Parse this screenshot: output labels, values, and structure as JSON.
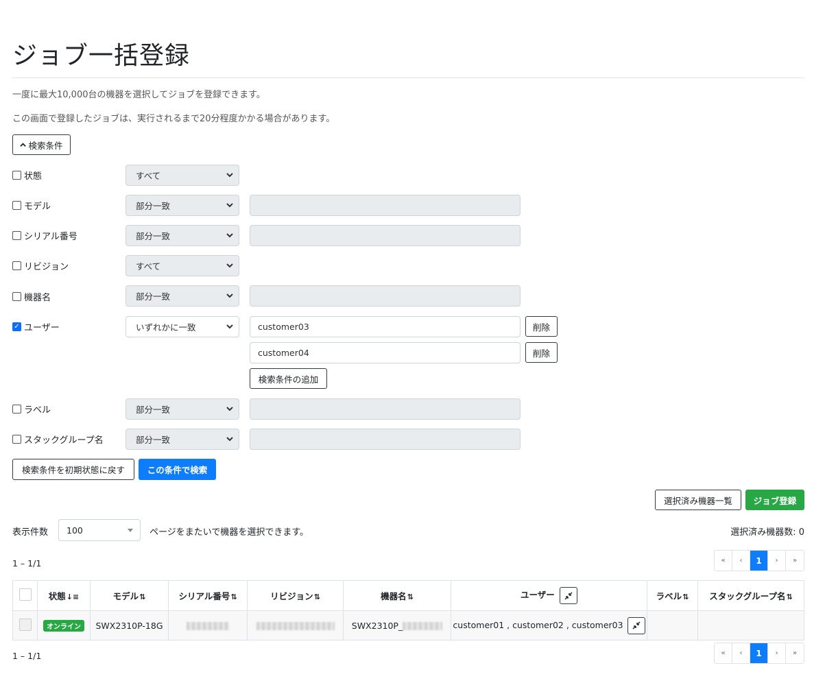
{
  "page": {
    "title": "ジョブ一括登録",
    "desc1": "一度に最大10,000台の機器を選択してジョブを登録できます。",
    "desc2": "この画面で登録したジョブは、実行されるまで20分程度かかる場合があります。"
  },
  "search": {
    "toggle_label": "検索条件",
    "conditions": [
      {
        "label": "状態",
        "checked": false,
        "match": "すべて"
      },
      {
        "label": "モデル",
        "checked": false,
        "match": "部分一致",
        "value": ""
      },
      {
        "label": "シリアル番号",
        "checked": false,
        "match": "部分一致",
        "value": ""
      },
      {
        "label": "リビジョン",
        "checked": false,
        "match": "すべて"
      },
      {
        "label": "機器名",
        "checked": false,
        "match": "部分一致",
        "value": ""
      },
      {
        "label": "ユーザー",
        "checked": true,
        "match": "いずれかに一致",
        "values": [
          "customer03",
          "customer04"
        ]
      },
      {
        "label": "ラベル",
        "checked": false,
        "match": "部分一致",
        "value": ""
      },
      {
        "label": "スタックグループ名",
        "checked": false,
        "match": "部分一致",
        "value": ""
      }
    ],
    "delete_label": "削除",
    "add_condition_label": "検索条件の追加",
    "reset_label": "検索条件を初期状態に戻す",
    "search_label": "この条件で検索"
  },
  "actions": {
    "selected_list_label": "選択済み機器一覧",
    "register_label": "ジョブ登録"
  },
  "listing": {
    "per_page_label": "表示件数",
    "per_page_value": "100",
    "cross_page_note": "ページをまたいで機器を選択できます。",
    "selected_count": "選択済み機器数: 0",
    "range_top": "1 – 1/1",
    "range_bottom": "1 – 1/1"
  },
  "pagination": {
    "first": "«",
    "prev": "‹",
    "current": "1",
    "next": "›",
    "last": "»"
  },
  "table": {
    "headers": {
      "status": "状態",
      "model": "モデル",
      "serial": "シリアル番号",
      "revision": "リビジョン",
      "name": "機器名",
      "user": "ユーザー",
      "label": "ラベル",
      "stack": "スタックグループ名"
    },
    "rows": [
      {
        "status": "オンライン",
        "model": "SWX2310P-18G",
        "name_prefix": "SWX2310P_",
        "users": "customer01 , customer02 , customer03",
        "label": "",
        "stack": ""
      }
    ]
  },
  "colors": {
    "primary": "#0d7dfc",
    "success": "#28a745",
    "disabled_bg": "#e9ecef"
  },
  "icons": {
    "toggle": "chevron-up-icon",
    "select": "chevron-down-icon",
    "collapse": "compress-icon",
    "sort": "sort-icon"
  }
}
